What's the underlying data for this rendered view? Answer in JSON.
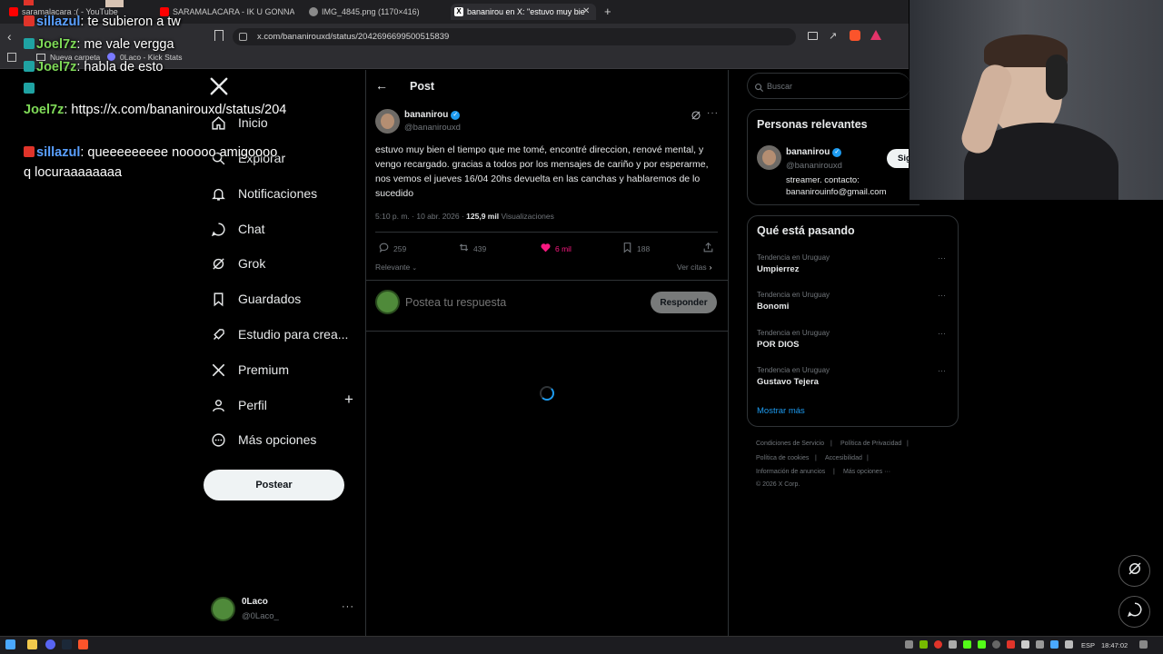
{
  "browser": {
    "tabs": [
      {
        "label": "saramalacara :( - YouTube",
        "favicon_color": "#ff0000",
        "active": false
      },
      {
        "label": "SARAMALACARA - IK U GONNA DIG",
        "favicon_color": "#ff0000",
        "active": false
      },
      {
        "label": "IMG_4845.png (1170×416)",
        "favicon_color": "#8a8a8a",
        "active": false
      },
      {
        "label": "bananirou en X: \"estuvo muy bie",
        "favicon_color": "#ffffff",
        "active": true
      }
    ],
    "url": "x.com/bananirouxd/status/2042696699500515839",
    "bookmarks": [
      {
        "label": "Nueva carpeta"
      },
      {
        "label": "0Laco - Kick Stats"
      }
    ]
  },
  "chat_overlay": {
    "lines": [
      {
        "user": "sillazul",
        "sep": ":",
        "text": " te subieron a tw",
        "user_color": "#5aa0ff",
        "badge_color": "#e0342a"
      },
      {
        "user": "Joel7z",
        "sep": ":",
        "text": " me vale vergga",
        "user_color": "#7ed957",
        "badge_color": "#1fa3a3"
      },
      {
        "user": "Joel7z",
        "sep": ":",
        "text": " habla de esto",
        "user_color": "#7ed957",
        "badge_color": "#1fa3a3"
      },
      {
        "user": "Joel7z",
        "sep": ":",
        "text": " https://x.com/bananirouxd/status/204",
        "user_color": "#7ed957",
        "badge_color": "#1fa3a3"
      },
      {
        "user": "sillazul",
        "sep": ":",
        "text": " queeeeeeeee nooooo amigoooo",
        "user_color": "#5aa0ff",
        "badge_color": "#e0342a"
      },
      {
        "user": "",
        "sep": "",
        "text": "q locuraaaaaaaa",
        "user_color": "#ffffff",
        "badge_color": ""
      }
    ]
  },
  "nav": {
    "items": [
      {
        "label": "Inicio",
        "icon": "home-icon"
      },
      {
        "label": "Explorar",
        "icon": "search-icon"
      },
      {
        "label": "Notificaciones",
        "icon": "bell-icon"
      },
      {
        "label": "Chat",
        "icon": "chat-icon"
      },
      {
        "label": "Grok",
        "icon": "grok-icon"
      },
      {
        "label": "Guardados",
        "icon": "bookmark-icon"
      },
      {
        "label": "Estudio para crea...",
        "icon": "rocket-icon"
      },
      {
        "label": "Premium",
        "icon": "x-logo-icon"
      },
      {
        "label": "Perfil",
        "icon": "person-icon"
      },
      {
        "label": "Más opciones",
        "icon": "more-circle-icon"
      }
    ],
    "post_button": "Postear",
    "account": {
      "name": "0Laco",
      "handle": "@0Laco_"
    }
  },
  "post": {
    "header_title": "Post",
    "author_name": "bananirou",
    "author_handle": "@bananirouxd",
    "text": "estuvo muy bien el tiempo que me tomé, encontré direccion, renové mental, y vengo recargado. gracias a todos por los mensajes de cariño y por esperarme, nos vemos el jueves 16/04 20hs devuelta en las canchas y hablaremos de lo sucedido",
    "time": "5:10 p. m. · 10 abr. 2026 · ",
    "views_count": "125,9 mil",
    "views_label": " Visualizaciones",
    "replies": "259",
    "reposts": "439",
    "likes": "6 mil",
    "bookmarks": "188",
    "sort_label": "Relevante",
    "quotes_label": "Ver citas",
    "reply_placeholder": "Postea tu respuesta",
    "reply_button": "Responder",
    "like_color": "#f91880"
  },
  "sidebar": {
    "search_placeholder": "Buscar",
    "relevant": {
      "title": "Personas relevantes",
      "name": "bananirou",
      "handle": "@bananirouxd",
      "bio_line1": "streamer. contacto:",
      "bio_line2": "bananirouinfo@gmail.com",
      "follow_label": "Sig"
    },
    "trends": {
      "title": "Qué está pasando",
      "items": [
        {
          "context": "Tendencia en Uruguay",
          "name": "Umpierrez"
        },
        {
          "context": "Tendencia en Uruguay",
          "name": "Bonomi"
        },
        {
          "context": "Tendencia en Uruguay",
          "name": "POR DIOS"
        },
        {
          "context": "Tendencia en Uruguay",
          "name": "Gustavo Tejera"
        }
      ],
      "more_label": "Mostrar más"
    },
    "footer": {
      "links": [
        "Condiciones de Servicio",
        "Política de Privacidad",
        "Política de cookies",
        "Accesibilidad",
        "Información de anuncios",
        "Más opciones ···"
      ],
      "copyright": "© 2026 X Corp."
    }
  },
  "taskbar": {
    "clock": "18:47:02",
    "lang": "ESP"
  }
}
